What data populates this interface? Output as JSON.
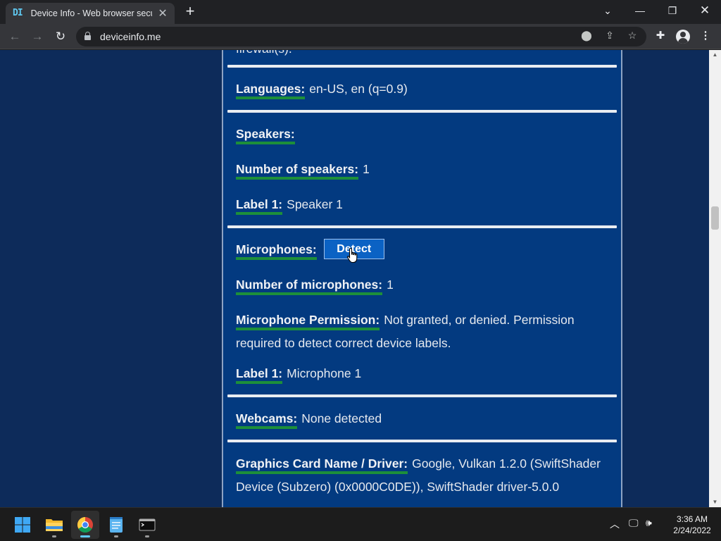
{
  "browser": {
    "tab_title": "Device Info - Web browser security",
    "favicon_text": "DI",
    "url": "deviceinfo.me"
  },
  "page": {
    "partial_text": "firewall(s).",
    "languages": {
      "label": "Languages:",
      "value": "en-US, en (q=0.9)"
    },
    "speakers": {
      "label": "Speakers:",
      "count_label": "Number of speakers:",
      "count": "1",
      "label1_label": "Label 1:",
      "label1_value": "Speaker 1"
    },
    "microphones": {
      "label": "Microphones:",
      "detect_button": "Detect",
      "count_label": "Number of microphones:",
      "count": "1",
      "permission_label": "Microphone Permission:",
      "permission_value": "Not granted, or denied. Permission required to detect correct device labels.",
      "label1_label": "Label 1:",
      "label1_value": "Microphone 1"
    },
    "webcams": {
      "label": "Webcams:",
      "value": "None detected"
    },
    "graphics": {
      "label": "Graphics Card Name / Driver:",
      "value": "Google, Vulkan 1.2.0 (SwiftShader Device (Subzero) (0x0000C0DE)), SwiftShader driver-5.0.0"
    }
  },
  "taskbar": {
    "time": "3:36 AM",
    "date": "2/24/2022"
  },
  "colors": {
    "page_background": "#0d2b5a",
    "panel_background": "#033a80",
    "label_underline": "#1d8f3a",
    "button": "#0b62c4"
  }
}
